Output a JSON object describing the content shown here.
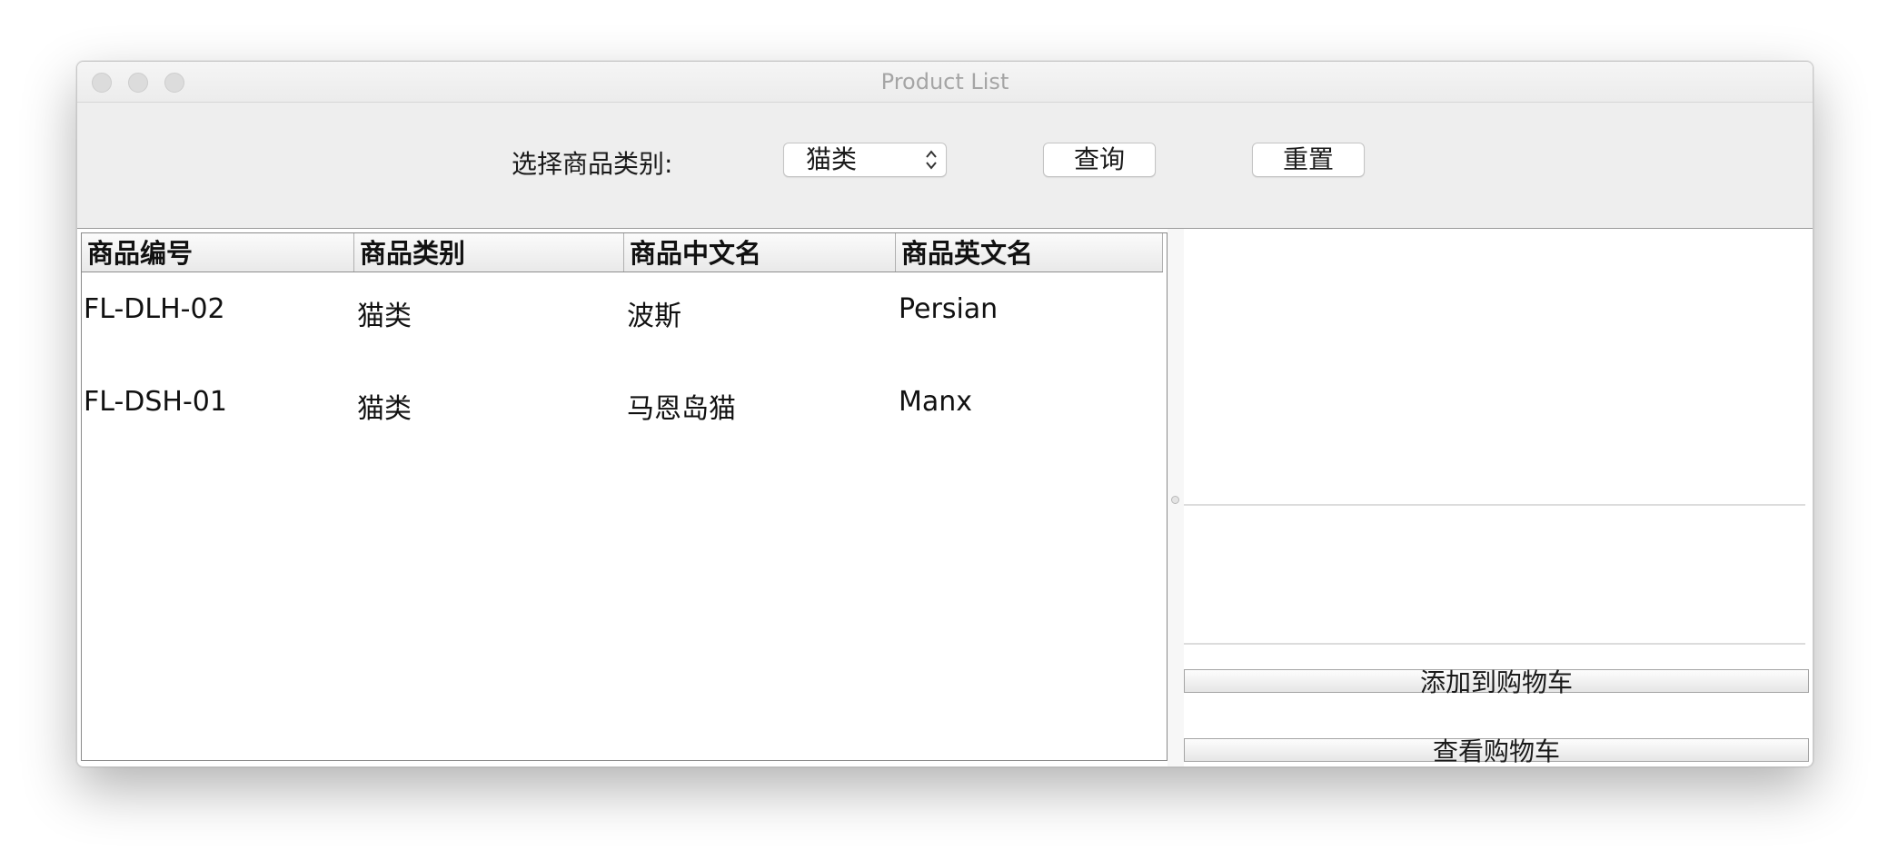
{
  "window": {
    "title": "Product List"
  },
  "toolbar": {
    "category_label": "选择商品类别:",
    "category_select": {
      "selected": "猫类"
    },
    "query_label": "查询",
    "reset_label": "重置"
  },
  "table": {
    "columns": [
      "商品编号",
      "商品类别",
      "商品中文名",
      "商品英文名"
    ],
    "rows": [
      [
        "FL-DLH-02",
        "猫类",
        "波斯",
        "Persian"
      ],
      [
        "FL-DSH-01",
        "猫类",
        "马恩岛猫",
        "Manx"
      ]
    ]
  },
  "actions": {
    "add_to_cart_label": "添加到购物车",
    "view_cart_label": "查看购物车"
  },
  "icons": {
    "select": "chevron-up-down-icon"
  }
}
